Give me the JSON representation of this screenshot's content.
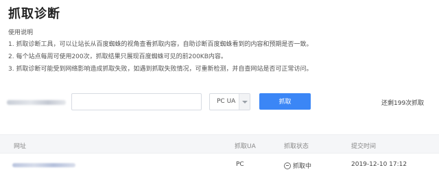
{
  "page": {
    "title": "抓取诊断"
  },
  "usage": {
    "heading": "使用说明",
    "lines": [
      "1. 抓取诊断工具，可以让站长从百度蜘蛛的视角查看抓取内容，自助诊断百度蜘蛛看到的内容和预期是否一致。",
      "2. 每个站点每周可使用200次，抓取结果只展现百度蜘蛛可见的前200KB内容。",
      "3. 抓取诊断可能受到网络影响造成抓取失败，如遇到抓取失败情况，可重新检测，并自查网站是否可正常访问。"
    ]
  },
  "form": {
    "url_input_value": "",
    "ua_selected": "PC UA",
    "fetch_button": "抓取",
    "remaining_text": "还剩199次抓取"
  },
  "table": {
    "headers": [
      "网址",
      "抓取UA",
      "抓取状态",
      "提交时间"
    ],
    "rows": [
      {
        "ua": "PC",
        "status": "抓取中",
        "time": "2019-12-10 17:12"
      }
    ]
  },
  "colors": {
    "primary": "#3b86f6",
    "header_bg": "#f5f6f8"
  }
}
